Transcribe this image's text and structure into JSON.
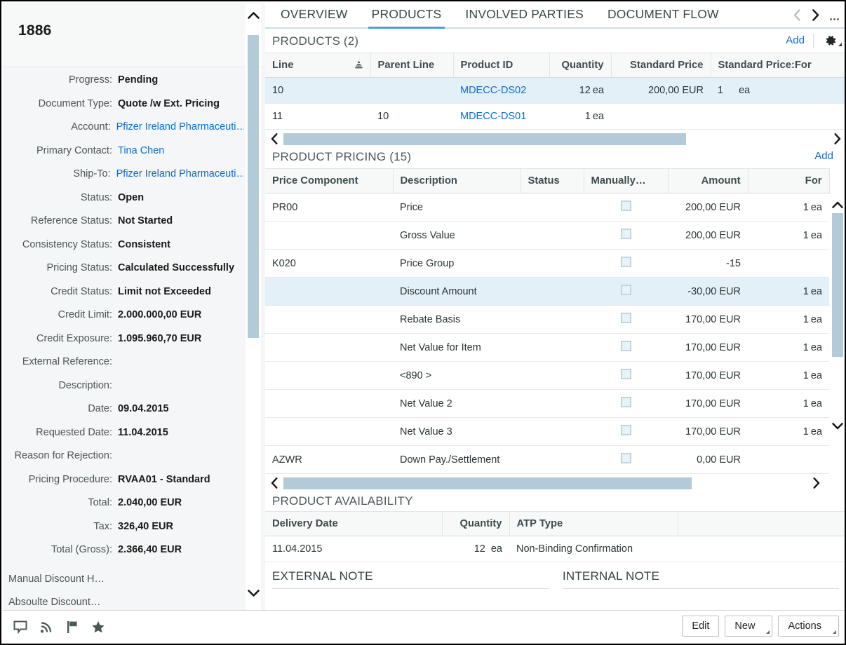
{
  "left": {
    "doc_number": "1886",
    "fields": [
      {
        "label": "Progress:",
        "value": "Pending",
        "link": false
      },
      {
        "label": "Document Type:",
        "value": "Quote /w Ext. Pricing",
        "link": false
      },
      {
        "label": "Account:",
        "value": "Pfizer Ireland Pharmaceuti…",
        "link": true
      },
      {
        "label": "Primary Contact:",
        "value": "Tina Chen",
        "link": true
      },
      {
        "label": "Ship-To:",
        "value": "Pfizer Ireland Pharmaceuti…",
        "link": true
      },
      {
        "label": "Status:",
        "value": "Open",
        "link": false
      },
      {
        "label": "Reference Status:",
        "value": "Not Started",
        "link": false
      },
      {
        "label": "Consistency Status:",
        "value": "Consistent",
        "link": false
      },
      {
        "label": "Pricing Status:",
        "value": "Calculated Successfully",
        "link": false
      },
      {
        "label": "Credit Status:",
        "value": "Limit not Exceeded",
        "link": false
      },
      {
        "label": "Credit Limit:",
        "value": "2.000.000,00 EUR",
        "link": false
      },
      {
        "label": "Credit Exposure:",
        "value": "1.095.960,70 EUR",
        "link": false
      },
      {
        "label": "External Reference:",
        "value": "",
        "link": false
      },
      {
        "label": "Description:",
        "value": "",
        "link": false
      },
      {
        "label": "Date:",
        "value": "09.04.2015",
        "link": false
      },
      {
        "label": "Requested Date:",
        "value": "11.04.2015",
        "link": false
      },
      {
        "label": "Reason for Rejection:",
        "value": "",
        "link": false
      },
      {
        "label": "Pricing Procedure:",
        "value": "RVAA01 - Standard",
        "link": false
      },
      {
        "label": "Total:",
        "value": "2.040,00 EUR",
        "link": false
      },
      {
        "label": "Tax:",
        "value": "326,40 EUR",
        "link": false
      },
      {
        "label": "Total (Gross):",
        "value": "2.366,40 EUR",
        "link": false
      }
    ],
    "truncated_fields": [
      {
        "label": "Manual Discount H…"
      },
      {
        "label": "Absoulte Discount…"
      }
    ]
  },
  "tabs": [
    {
      "label": "OVERVIEW",
      "active": false
    },
    {
      "label": "PRODUCTS",
      "active": true
    },
    {
      "label": "INVOLVED PARTIES",
      "active": false
    },
    {
      "label": "DOCUMENT FLOW",
      "active": false
    }
  ],
  "tab_nav": {
    "prev_icon": "chevron-left-icon",
    "next_icon": "chevron-right-icon",
    "overflow_icon": "overflow-dots-icon"
  },
  "products": {
    "title": "PRODUCTS (2)",
    "add_label": "Add",
    "settings_icon": "gear-icon",
    "columns": [
      "Line",
      "Parent Line",
      "Product ID",
      "Quantity",
      "Standard Price",
      "Standard Price:For"
    ],
    "rows": [
      {
        "line": "10",
        "parent_line": "",
        "product_id": "MDECC-DS02",
        "quantity": "12",
        "quantity_unit": "ea",
        "standard_price": "200,00 EUR",
        "price_for": "1",
        "price_for_unit": "ea",
        "selected": true
      },
      {
        "line": "11",
        "parent_line": "10",
        "product_id": "MDECC-DS01",
        "quantity": "1",
        "quantity_unit": "ea",
        "standard_price": "",
        "price_for": "",
        "price_for_unit": "",
        "selected": false
      }
    ]
  },
  "pricing": {
    "title": "PRODUCT PRICING (15)",
    "add_label": "Add",
    "columns": [
      "Price Component",
      "Description",
      "Status",
      "Manually…",
      "Amount",
      "For"
    ],
    "rows": [
      {
        "component": "PR00",
        "description": "Price",
        "status": "",
        "manual": false,
        "amount": "200,00 EUR",
        "for": "1",
        "for_unit": "ea",
        "selected": false
      },
      {
        "component": "",
        "description": "Gross Value",
        "status": "",
        "manual": false,
        "amount": "200,00 EUR",
        "for": "1",
        "for_unit": "ea",
        "selected": false
      },
      {
        "component": "K020",
        "description": "Price Group",
        "status": "",
        "manual": false,
        "amount": "-15",
        "for": "",
        "for_unit": "",
        "selected": false
      },
      {
        "component": "",
        "description": "Discount Amount",
        "status": "",
        "manual": false,
        "amount": "-30,00 EUR",
        "for": "1",
        "for_unit": "ea",
        "selected": true
      },
      {
        "component": "",
        "description": "Rebate Basis",
        "status": "",
        "manual": false,
        "amount": "170,00 EUR",
        "for": "1",
        "for_unit": "ea",
        "selected": false
      },
      {
        "component": "",
        "description": "Net Value for Item",
        "status": "",
        "manual": false,
        "amount": "170,00 EUR",
        "for": "1",
        "for_unit": "ea",
        "selected": false
      },
      {
        "component": "",
        "description": "<890 >",
        "status": "",
        "manual": false,
        "amount": "170,00 EUR",
        "for": "1",
        "for_unit": "ea",
        "selected": false
      },
      {
        "component": "",
        "description": "Net Value 2",
        "status": "",
        "manual": false,
        "amount": "170,00 EUR",
        "for": "1",
        "for_unit": "ea",
        "selected": false
      },
      {
        "component": "",
        "description": "Net Value 3",
        "status": "",
        "manual": false,
        "amount": "170,00 EUR",
        "for": "1",
        "for_unit": "ea",
        "selected": false
      },
      {
        "component": "AZWR",
        "description": "Down Pay./Settlement",
        "status": "",
        "manual": false,
        "amount": "0,00 EUR",
        "for": "",
        "for_unit": "",
        "selected": false
      }
    ]
  },
  "availability": {
    "title": "PRODUCT AVAILABILITY",
    "columns": [
      "Delivery Date",
      "Quantity",
      "ATP Type",
      ""
    ],
    "rows": [
      {
        "delivery_date": "11.04.2015",
        "quantity": "12",
        "quantity_unit": "ea",
        "atp_type": "Non-Binding Confirmation",
        "extra": ""
      }
    ]
  },
  "notes": {
    "external_title": "EXTERNAL NOTE",
    "internal_title": "INTERNAL NOTE"
  },
  "footer": {
    "icons": [
      {
        "name": "chat-bubble-icon"
      },
      {
        "name": "rss-feed-icon"
      },
      {
        "name": "flag-icon"
      },
      {
        "name": "star-icon"
      }
    ],
    "buttons": [
      {
        "label": "Edit",
        "menu": false
      },
      {
        "label": "New",
        "menu": true
      },
      {
        "label": "Actions",
        "menu": true
      }
    ]
  },
  "colors": {
    "accent": "#0a6ed1",
    "tab_underline": "#4a9fe0",
    "selection": "#e4f0f7",
    "scroll_thumb": "#b3cbd9",
    "panel_bg": "#f4f6f7"
  }
}
